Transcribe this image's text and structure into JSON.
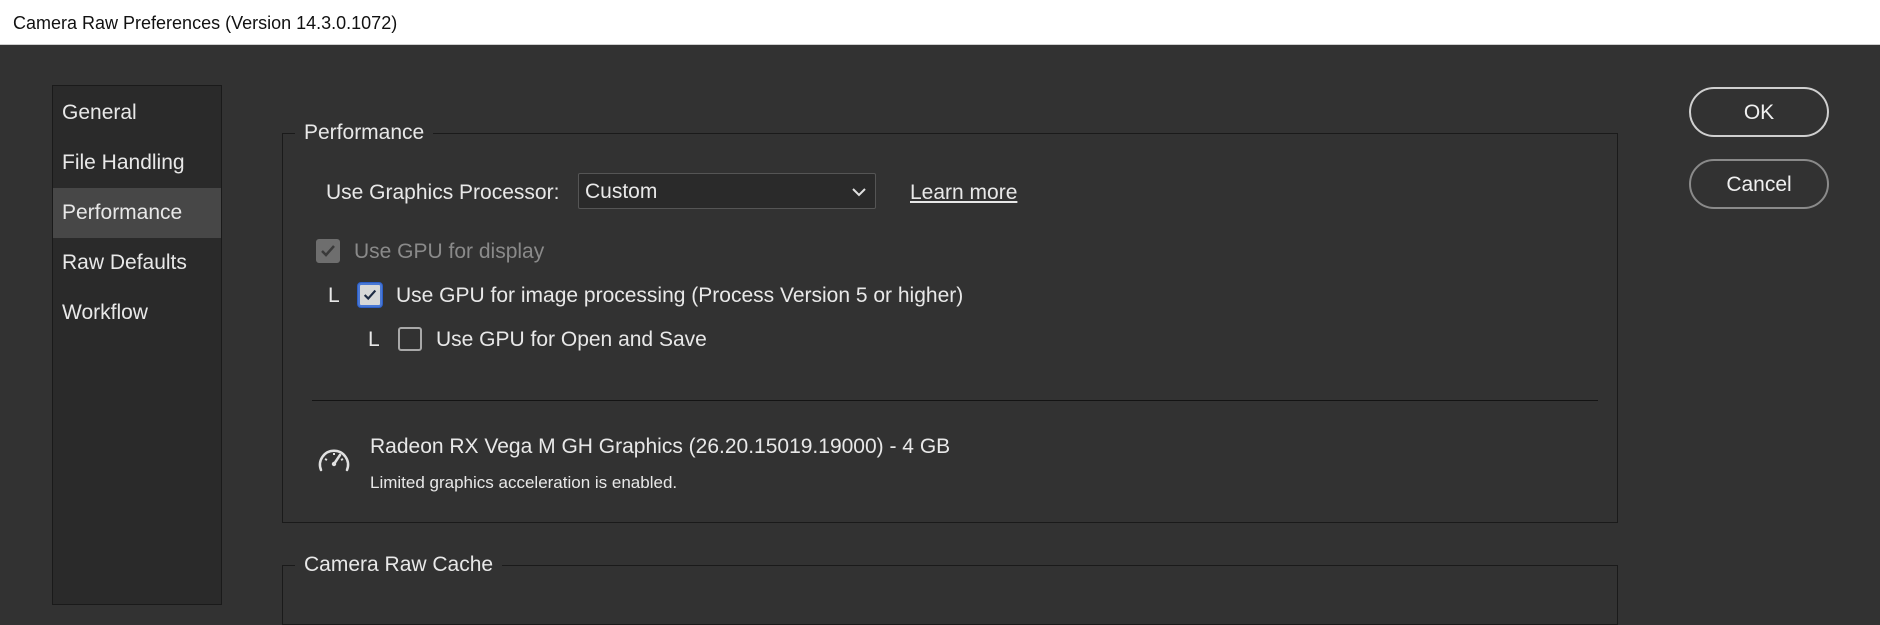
{
  "window": {
    "title": "Camera Raw Preferences  (Version 14.3.0.1072)"
  },
  "sidebar": {
    "items": [
      {
        "label": "General"
      },
      {
        "label": "File Handling"
      },
      {
        "label": "Performance"
      },
      {
        "label": "Raw Defaults"
      },
      {
        "label": "Workflow"
      }
    ],
    "active": "Performance"
  },
  "performance": {
    "legend": "Performance",
    "gpu_label": "Use Graphics Processor:",
    "gpu_select_value": "Custom",
    "learn_more": "Learn more",
    "use_gpu_display": "Use GPU for display",
    "tree_marker_1": "L",
    "use_gpu_processing": "Use GPU for image processing (Process Version 5 or higher)",
    "tree_marker_2": "L",
    "use_gpu_open_save": "Use GPU for Open and Save",
    "gpu_name": "Radeon RX Vega M GH Graphics (26.20.15019.19000) - 4 GB",
    "gpu_status": "Limited graphics acceleration is enabled."
  },
  "cache": {
    "legend": "Camera Raw Cache"
  },
  "buttons": {
    "ok": "OK",
    "cancel": "Cancel"
  },
  "icons": {
    "chevron": "chevron-down-icon",
    "check": "checkmark-icon",
    "gauge": "speedometer-icon"
  },
  "colors": {
    "background": "#323232",
    "panel": "#2a2a2a",
    "active_item": "#474747",
    "focus_ring": "#4a78d4"
  }
}
